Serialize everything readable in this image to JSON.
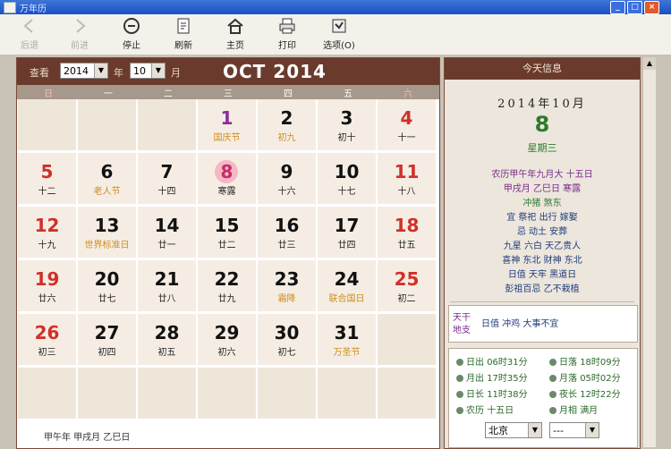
{
  "window": {
    "title": "万年历"
  },
  "toolbar": {
    "items": [
      {
        "label": "后退",
        "disabled": true
      },
      {
        "label": "前进",
        "disabled": true
      },
      {
        "label": "停止"
      },
      {
        "label": "刷新"
      },
      {
        "label": "主页"
      },
      {
        "label": "打印"
      },
      {
        "label": "选项(O)"
      }
    ]
  },
  "calendar": {
    "year_label": "查看",
    "year_value": "2014",
    "month_sep": "年",
    "month_value": "10",
    "month_suffix": "月",
    "title": "OCT 2014",
    "weekdays": [
      "日",
      "一",
      "二",
      "三",
      "四",
      "五",
      "六"
    ],
    "days": [
      {
        "n": "",
        "l": ""
      },
      {
        "n": "",
        "l": ""
      },
      {
        "n": "",
        "l": ""
      },
      {
        "n": "1",
        "l": "国庆节",
        "c": "purple",
        "lc": "fest"
      },
      {
        "n": "2",
        "l": "初九",
        "lc": "fest"
      },
      {
        "n": "3",
        "l": "初十"
      },
      {
        "n": "4",
        "l": "十一",
        "c": "red"
      },
      {
        "n": "5",
        "l": "十二",
        "c": "red"
      },
      {
        "n": "6",
        "l": "老人节",
        "lc": "fest"
      },
      {
        "n": "7",
        "l": "十四"
      },
      {
        "n": "8",
        "l": "寒露",
        "today": true
      },
      {
        "n": "9",
        "l": "十六"
      },
      {
        "n": "10",
        "l": "十七"
      },
      {
        "n": "11",
        "l": "十八",
        "c": "red"
      },
      {
        "n": "12",
        "l": "十九",
        "c": "red"
      },
      {
        "n": "13",
        "l": "世界标准日",
        "lc": "fest"
      },
      {
        "n": "14",
        "l": "廿一"
      },
      {
        "n": "15",
        "l": "廿二"
      },
      {
        "n": "16",
        "l": "廿三"
      },
      {
        "n": "17",
        "l": "廿四"
      },
      {
        "n": "18",
        "l": "廿五",
        "c": "red"
      },
      {
        "n": "19",
        "l": "廿六",
        "c": "red"
      },
      {
        "n": "20",
        "l": "廿七"
      },
      {
        "n": "21",
        "l": "廿八"
      },
      {
        "n": "22",
        "l": "廿九"
      },
      {
        "n": "23",
        "l": "霜降",
        "lc": "fest"
      },
      {
        "n": "24",
        "l": "联合国日",
        "lc": "fest"
      },
      {
        "n": "25",
        "l": "初二",
        "c": "red"
      },
      {
        "n": "26",
        "l": "初三",
        "c": "red"
      },
      {
        "n": "27",
        "l": "初四"
      },
      {
        "n": "28",
        "l": "初五"
      },
      {
        "n": "29",
        "l": "初六"
      },
      {
        "n": "30",
        "l": "初七"
      },
      {
        "n": "31",
        "l": "万圣节",
        "lc": "fest"
      },
      {
        "n": "",
        "l": ""
      },
      {
        "n": "",
        "l": ""
      },
      {
        "n": "",
        "l": ""
      },
      {
        "n": "",
        "l": ""
      },
      {
        "n": "",
        "l": ""
      },
      {
        "n": "",
        "l": ""
      },
      {
        "n": "",
        "l": ""
      },
      {
        "n": "",
        "l": ""
      }
    ],
    "footer": "甲午年 甲戌月 乙巳日"
  },
  "side": {
    "header": "今天信息",
    "date": "2014年10月",
    "day": "8",
    "weekday": "星期三",
    "lines": [
      {
        "t": "农历甲午年九月大 十五日",
        "c": "#7a2a8a"
      },
      {
        "t": "甲戌月 乙巳日 寒露",
        "c": "#7a2a8a"
      },
      {
        "t": "冲猪 煞东",
        "c": "#2e7a2e"
      },
      {
        "t": "宜 祭祀 出行 嫁娶",
        "c": "#1f3b7a"
      },
      {
        "t": "忌 动土 安葬",
        "c": "#1f3b7a"
      },
      {
        "t": "九星 六白 天乙贵人",
        "c": "#1f3b7a"
      },
      {
        "t": "喜神 东北 财神 东北",
        "c": "#1f3b7a"
      },
      {
        "t": "日值 天牢 黑道日",
        "c": "#1f3b7a"
      },
      {
        "t": "彭祖百忌 乙不栽植",
        "c": "#1f3b7a"
      }
    ],
    "note1": "天干",
    "note2": "地支",
    "note_text": "日值 冲鸡 大事不宜",
    "weather": [
      {
        "k": "日出",
        "v": "06时31分"
      },
      {
        "k": "日落",
        "v": "18时09分"
      },
      {
        "k": "月出",
        "v": "17时35分"
      },
      {
        "k": "月落",
        "v": "05时02分"
      },
      {
        "k": "日长",
        "v": "11时38分"
      },
      {
        "k": "夜长",
        "v": "12时22分"
      },
      {
        "k": "农历",
        "v": "十五日"
      },
      {
        "k": "月相",
        "v": "满月"
      }
    ],
    "select1": "北京",
    "select2": "---"
  }
}
